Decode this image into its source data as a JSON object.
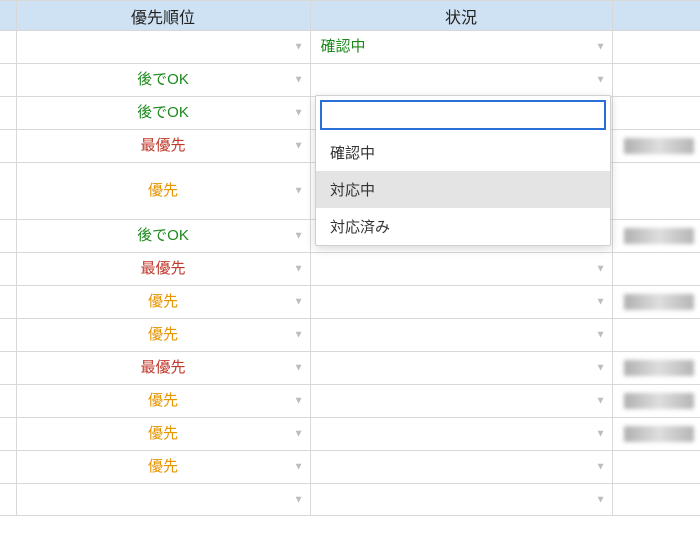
{
  "headers": {
    "priority": "優先順位",
    "status": "状況"
  },
  "rows": [
    {
      "priority": "",
      "pcolor": "",
      "status": "確認中",
      "scolor": "c-green",
      "tall": false,
      "blurred": false
    },
    {
      "priority": "後でOK",
      "pcolor": "c-green",
      "status": "",
      "scolor": "",
      "tall": false,
      "blurred": false
    },
    {
      "priority": "後でOK",
      "pcolor": "c-green",
      "status": "",
      "scolor": "",
      "tall": false,
      "blurred": false
    },
    {
      "priority": "最優先",
      "pcolor": "c-red",
      "status": "",
      "scolor": "",
      "tall": false,
      "blurred": true
    },
    {
      "priority": "優先",
      "pcolor": "c-orange",
      "status": "",
      "scolor": "",
      "tall": true,
      "blurred": false
    },
    {
      "priority": "後でOK",
      "pcolor": "c-green",
      "status": "",
      "scolor": "",
      "tall": false,
      "blurred": true
    },
    {
      "priority": "最優先",
      "pcolor": "c-red",
      "status": "",
      "scolor": "",
      "tall": false,
      "blurred": false
    },
    {
      "priority": "優先",
      "pcolor": "c-orange",
      "status": "",
      "scolor": "",
      "tall": false,
      "blurred": true
    },
    {
      "priority": "優先",
      "pcolor": "c-orange",
      "status": "",
      "scolor": "",
      "tall": false,
      "blurred": false
    },
    {
      "priority": "最優先",
      "pcolor": "c-red",
      "status": "",
      "scolor": "",
      "tall": false,
      "blurred": true
    },
    {
      "priority": "優先",
      "pcolor": "c-orange",
      "status": "",
      "scolor": "",
      "tall": false,
      "blurred": true
    },
    {
      "priority": "優先",
      "pcolor": "c-orange",
      "status": "",
      "scolor": "",
      "tall": false,
      "blurred": true
    },
    {
      "priority": "優先",
      "pcolor": "c-orange",
      "status": "",
      "scolor": "",
      "tall": false,
      "blurred": false
    },
    {
      "priority": "",
      "pcolor": "",
      "status": "",
      "scolor": "",
      "tall": false,
      "blurred": false
    }
  ],
  "dropdown": {
    "inputValue": "",
    "options": [
      "確認中",
      "対応中",
      "対応済み"
    ],
    "selectedIndex": 1
  }
}
